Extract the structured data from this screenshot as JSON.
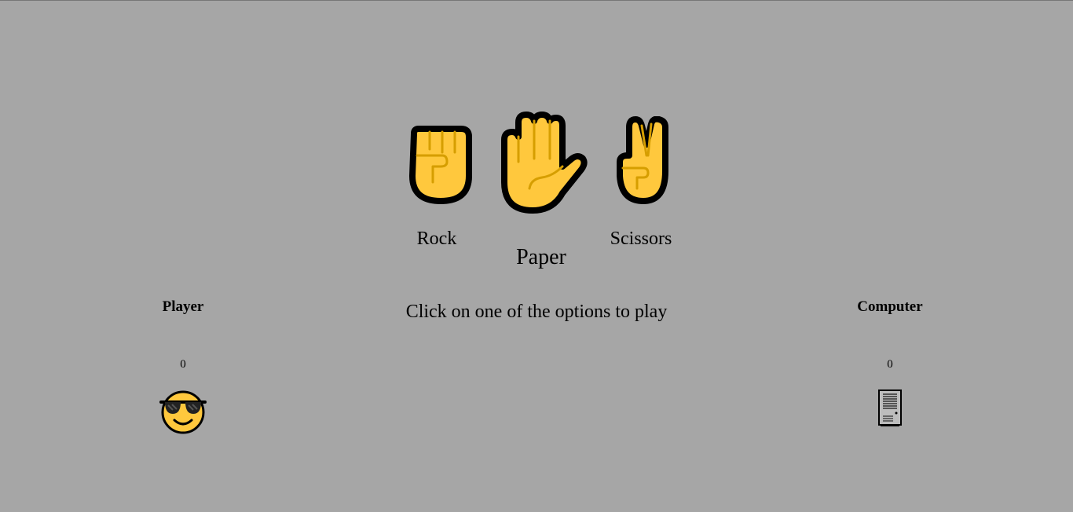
{
  "choices": {
    "rock": {
      "label": "Rock",
      "icon": "raised-fist-icon"
    },
    "paper": {
      "label": "Paper",
      "icon": "raised-hand-icon"
    },
    "scissors": {
      "label": "Scissors",
      "icon": "victory-hand-icon"
    }
  },
  "message": "Click on one of the options to play",
  "player": {
    "name": "Player",
    "score": "0",
    "icon": "sunglasses-face-icon"
  },
  "computer": {
    "name": "Computer",
    "score": "0",
    "icon": "desktop-computer-icon"
  },
  "colors": {
    "background": "#a6a6a6",
    "hand": "#ffc83d",
    "outline": "#000000",
    "crease": "#d69e00"
  }
}
